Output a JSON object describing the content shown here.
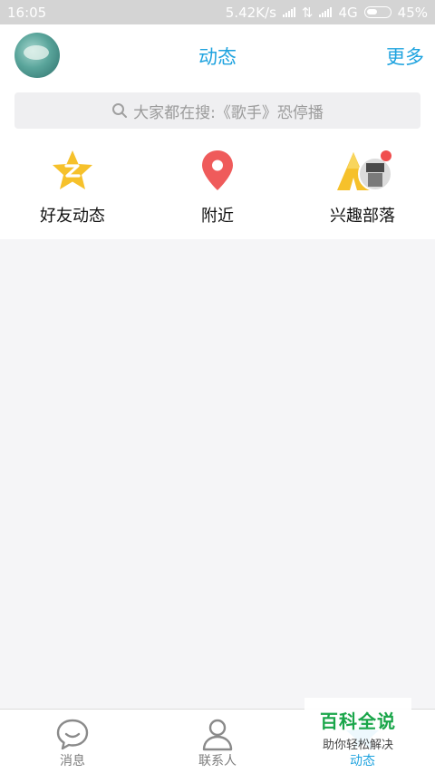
{
  "status": {
    "time": "16:05",
    "speed": "5.42K/s",
    "network": "4G",
    "battery": "45%"
  },
  "header": {
    "title": "动态",
    "more": "更多"
  },
  "search": {
    "placeholder": "大家都在搜:《歌手》恐停播"
  },
  "quick_items": [
    {
      "label": "好友动态",
      "icon": "friends-star-icon"
    },
    {
      "label": "附近",
      "icon": "location-pin-icon"
    },
    {
      "label": "兴趣部落",
      "icon": "tribe-tent-icon"
    }
  ],
  "tabs": [
    {
      "label": "消息",
      "icon": "chat-bubble-icon"
    },
    {
      "label": "联系人",
      "icon": "contact-person-icon"
    },
    {
      "label": "动态",
      "icon": "star-icon"
    }
  ],
  "watermark": {
    "line1": "百科全说",
    "line2": "助你轻松解决"
  },
  "colors": {
    "accent": "#1fa3df",
    "pin": "#ef5b5b",
    "star": "#f6c12b",
    "badge": "#f04d4d"
  }
}
